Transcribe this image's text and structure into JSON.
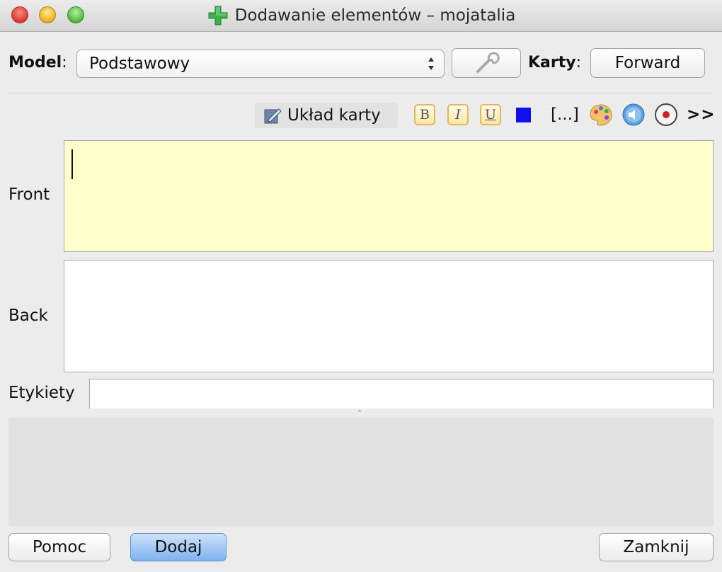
{
  "window": {
    "title": "Dodawanie elementów – mojatalia"
  },
  "model": {
    "label": "Model",
    "colon": ":",
    "selected": "Podstawowy"
  },
  "cards": {
    "label": "Karty",
    "colon": ":",
    "button": "Forward"
  },
  "toolbar": {
    "layout_label": "Układ karty",
    "bold": "B",
    "italic": "I",
    "underline": "U",
    "text_color": "#1010ee",
    "cloze": "[...]",
    "more": ">>",
    "icons": [
      "edit-layout-icon",
      "wrench-icon",
      "palette-icon",
      "speaker-icon",
      "record-icon"
    ]
  },
  "fields": [
    {
      "label": "Front",
      "value": ""
    },
    {
      "label": "Back",
      "value": ""
    }
  ],
  "tags": {
    "label": "Etykiety",
    "value": ""
  },
  "buttons": {
    "help": "Pomoc",
    "add": "Dodaj",
    "close": "Zamknij"
  },
  "colors": {
    "front_field_bg": "#ffffcc",
    "add_button": "#7eb2ee"
  }
}
